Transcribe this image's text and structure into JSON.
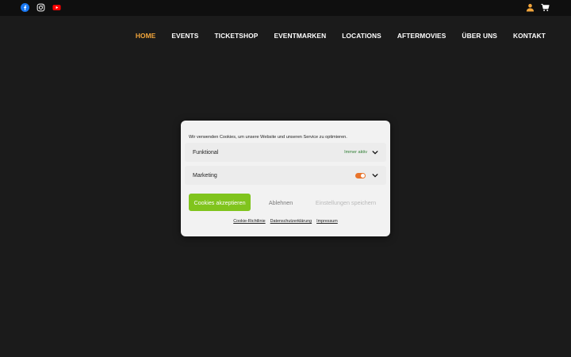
{
  "topbar": {
    "social": [
      {
        "icon": "facebook-icon",
        "color": "#1877f2"
      },
      {
        "icon": "instagram-icon",
        "color": "#ffffff"
      },
      {
        "icon": "youtube-icon",
        "color": "#ff0000"
      }
    ],
    "utilities": [
      {
        "icon": "user-icon",
        "color": "#f3a63b"
      },
      {
        "icon": "cart-icon",
        "color": "#ffffff"
      }
    ]
  },
  "nav": {
    "items": [
      {
        "label": "HOME",
        "active": true
      },
      {
        "label": "EVENTS"
      },
      {
        "label": "TICKETSHOP"
      },
      {
        "label": "EVENTMARKEN"
      },
      {
        "label": "LOCATIONS"
      },
      {
        "label": "AFTERMOVIES"
      },
      {
        "label": "ÜBER UNS"
      },
      {
        "label": "KONTAKT"
      }
    ],
    "active_color": "#f3a63b"
  },
  "cookie": {
    "intro": "Wir verwenden Cookies, um unsere Website und unseren Service zu optimieren.",
    "categories": [
      {
        "label": "Funktional",
        "status": "Immer aktiv"
      },
      {
        "label": "Marketing",
        "toggle_color": "#e8742b"
      }
    ],
    "buttons": {
      "accept": "Cookies akzeptieren",
      "deny": "Ablehnen",
      "save": "Einstellungen speichern"
    },
    "accept_color": "#80c41d",
    "links": [
      "Cookie-Richtlinie",
      "Datenschutzerklärung",
      "Impressum"
    ]
  }
}
